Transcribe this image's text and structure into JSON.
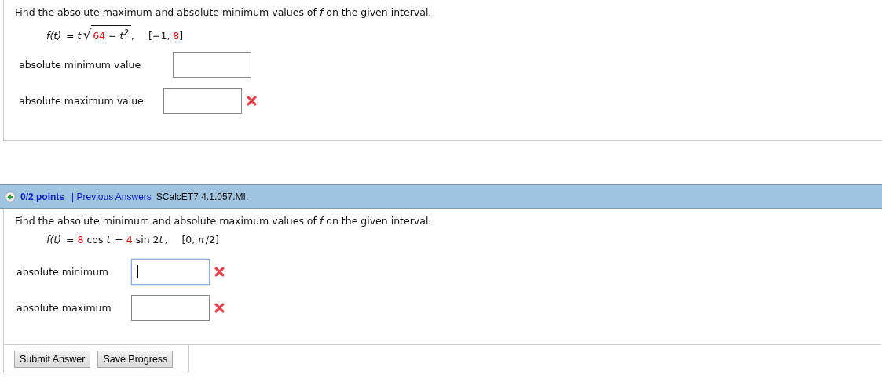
{
  "problems": [
    {
      "question": "Find the absolute maximum and absolute minimum values of *f* on the given interval.",
      "formula": [
        {
          "kind": "text",
          "text": "f(t)",
          "red": false,
          "italic": true
        },
        {
          "kind": "text",
          "text": " = ",
          "red": false,
          "italic": false
        },
        {
          "kind": "text",
          "text": "t",
          "red": false,
          "italic": true
        },
        {
          "kind": "sqrt",
          "symbol": "√",
          "children": [
            {
              "text": "64",
              "red": true,
              "italic": false
            },
            {
              "text": " − ",
              "red": false,
              "italic": false
            },
            {
              "text": "t$^{2}$",
              "red": false,
              "italic": true
            }
          ]
        },
        {
          "kind": "text",
          "text": ",",
          "red": false,
          "italic": false
        },
        {
          "kind": "gap"
        },
        {
          "kind": "text",
          "text": "[−1, ",
          "red": false,
          "italic": false
        },
        {
          "kind": "text",
          "text": "8",
          "red": true,
          "italic": false
        },
        {
          "kind": "text",
          "text": "]",
          "red": false,
          "italic": false
        }
      ],
      "answers": [
        {
          "label": "absolute minimum value",
          "focused": false,
          "wrong": false
        },
        {
          "label": "absolute maximum value",
          "focused": false,
          "wrong": true
        }
      ]
    },
    {
      "header": {
        "points": "0/2 points",
        "link": "| Previous Answers",
        "source": "SCalcET7 4.1.057.MI."
      },
      "question": "Find the absolute minimum and absolute maximum values of *f* on the given interval.",
      "formula": [
        {
          "kind": "text",
          "text": "f(t)",
          "red": false,
          "italic": true
        },
        {
          "kind": "text",
          "text": " = ",
          "red": false,
          "italic": false
        },
        {
          "kind": "text",
          "text": "8",
          "red": true,
          "italic": false
        },
        {
          "kind": "text",
          "text": " cos ",
          "red": false,
          "italic": false
        },
        {
          "kind": "text",
          "text": "t",
          "red": false,
          "italic": true
        },
        {
          "kind": "text",
          "text": " + ",
          "red": false,
          "italic": false
        },
        {
          "kind": "text",
          "text": "4",
          "red": true,
          "italic": false
        },
        {
          "kind": "text",
          "text": " sin 2",
          "red": false,
          "italic": false
        },
        {
          "kind": "text",
          "text": "t",
          "red": false,
          "italic": true
        },
        {
          "kind": "text",
          "text": ",",
          "red": false,
          "italic": false
        },
        {
          "kind": "gap"
        },
        {
          "kind": "text",
          "text": "[0, ",
          "red": false,
          "italic": false
        },
        {
          "kind": "text",
          "text": "π",
          "red": false,
          "italic": true
        },
        {
          "kind": "text",
          "text": "/2]",
          "red": false,
          "italic": false
        }
      ],
      "answers": [
        {
          "label": "absolute minimum",
          "focused": true,
          "wrong": true
        },
        {
          "label": "absolute maximum",
          "focused": false,
          "wrong": true
        }
      ],
      "buttons": [
        "Submit Answer",
        "Save Progress"
      ]
    }
  ]
}
